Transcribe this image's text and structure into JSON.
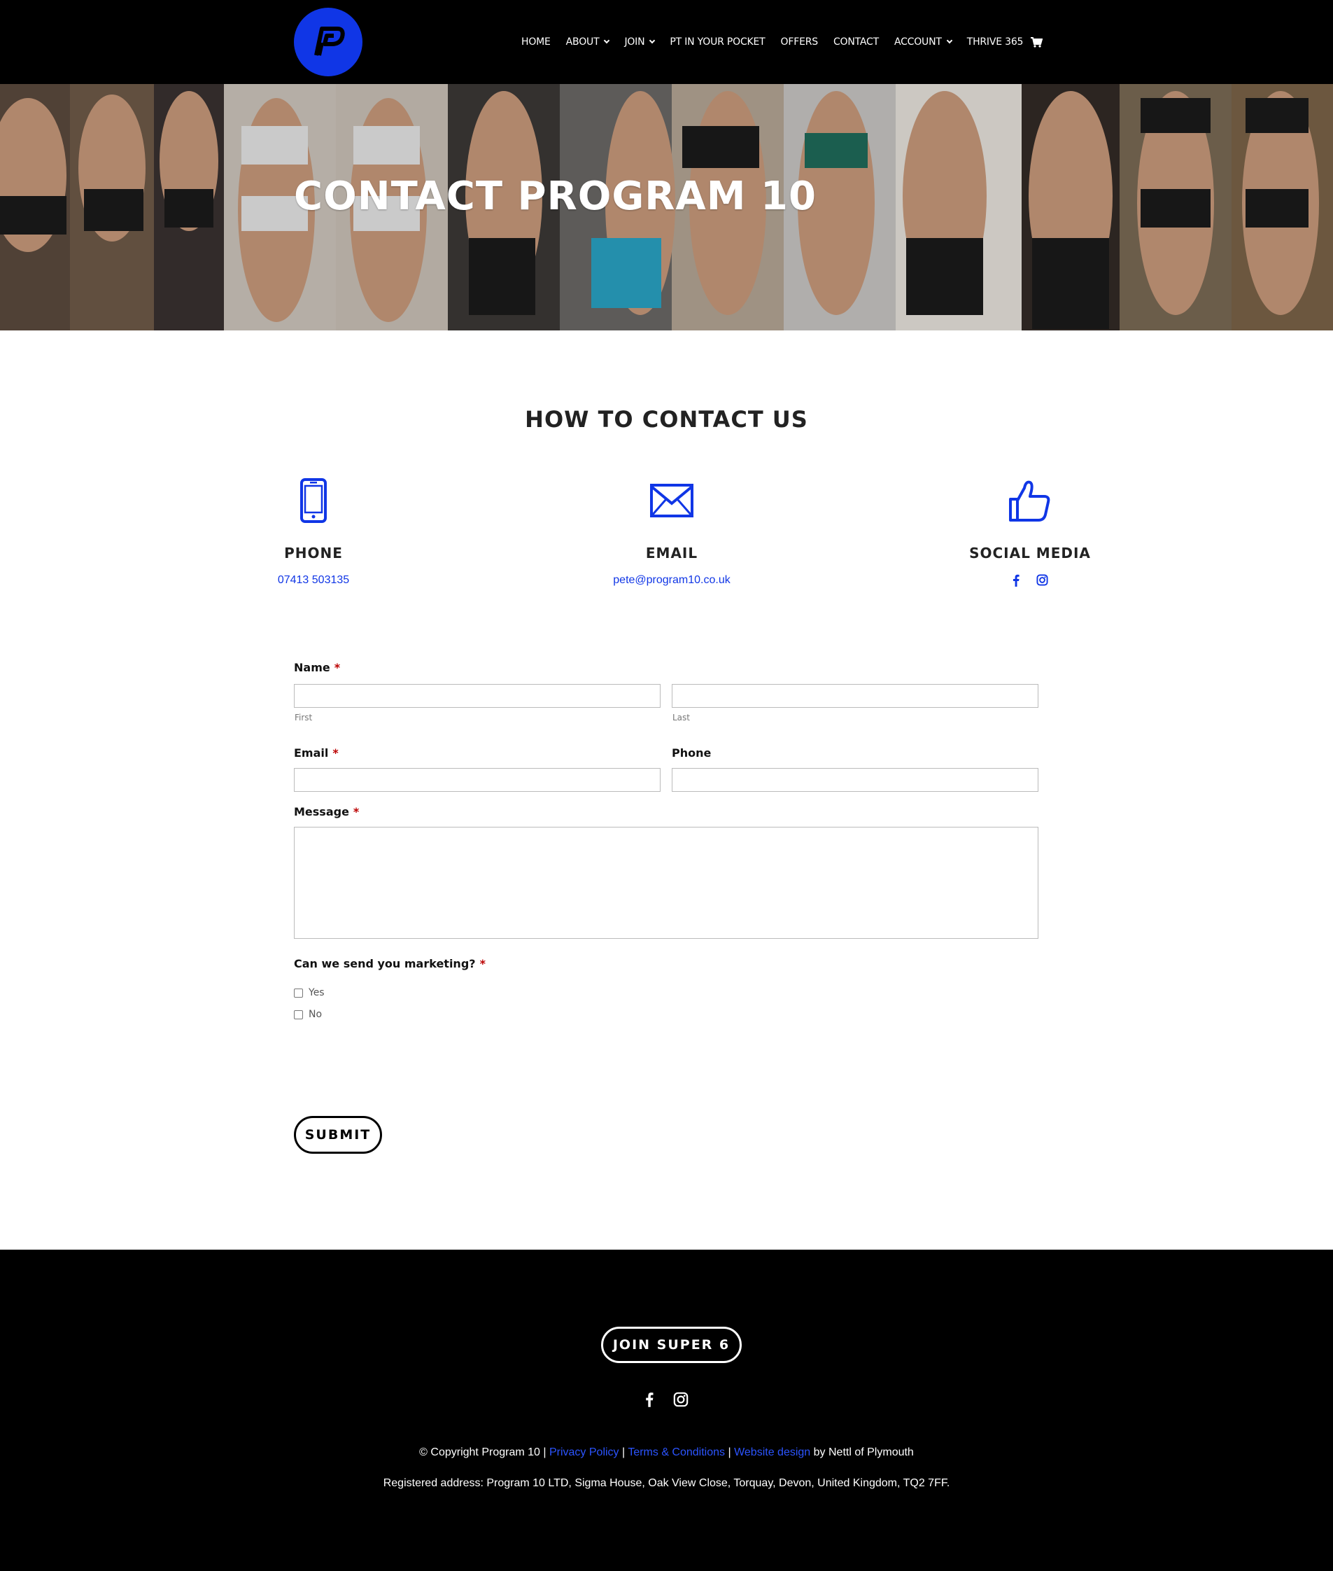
{
  "header": {
    "logo_letter": "P",
    "nav": [
      {
        "label": "HOME",
        "dropdown": false
      },
      {
        "label": "ABOUT",
        "dropdown": true
      },
      {
        "label": "JOIN",
        "dropdown": true
      },
      {
        "label": "PT IN YOUR POCKET",
        "dropdown": false
      },
      {
        "label": "OFFERS",
        "dropdown": false
      },
      {
        "label": "CONTACT",
        "dropdown": false
      },
      {
        "label": "ACCOUNT",
        "dropdown": true
      },
      {
        "label": "THRIVE 365",
        "dropdown": false
      }
    ],
    "cart_icon": "shopping-cart-icon"
  },
  "hero": {
    "title": "CONTACT PROGRAM 10"
  },
  "contact": {
    "title": "HOW TO CONTACT US",
    "phone": {
      "title": "PHONE",
      "value": "07413 503135",
      "icon": "mobile-phone-icon"
    },
    "email": {
      "title": "EMAIL",
      "value": "pete@program10.co.uk",
      "icon": "envelope-icon"
    },
    "social": {
      "title": "SOCIAL MEDIA",
      "icon": "thumbs-up-icon",
      "links": [
        "facebook-icon",
        "instagram-icon"
      ]
    }
  },
  "form": {
    "name_label": "Name",
    "first_sublabel": "First",
    "last_sublabel": "Last",
    "email_label": "Email",
    "phone_label": "Phone",
    "message_label": "Message",
    "marketing_label": "Can we send you marketing?",
    "required_mark": "*",
    "options": [
      "Yes",
      "No"
    ],
    "submit_label": "SUBMIT"
  },
  "footer": {
    "join_label": "JOIN SUPER 6",
    "copyright_prefix": "© Copyright Program 10 |",
    "privacy_link": "Privacy Policy",
    "sep1": "|",
    "terms_link": "Terms & Conditions",
    "sep2": "|",
    "design_link": "Website design",
    "design_suffix": "by Nettl of Plymouth",
    "address": "Registered address: Program 10 LTD, Sigma House, Oak View Close, Torquay, Devon, United Kingdom, TQ2 7FF."
  },
  "colors": {
    "accent": "#1036e6",
    "header_bg": "#000000",
    "footer_bg": "#000000",
    "link": "#2b54ff"
  }
}
